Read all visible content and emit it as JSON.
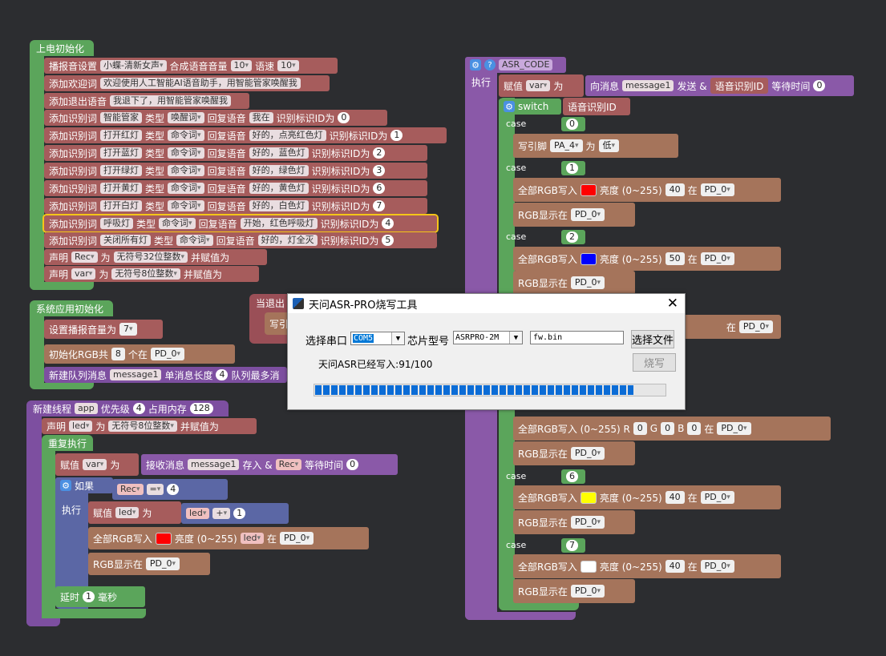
{
  "blocks": {
    "power_on": {
      "title": "上电初始化",
      "tts": {
        "label1": "播报音设置",
        "voice": "小蝶-清新女声",
        "label2": "合成语音音量",
        "volume": "10",
        "label3": "语速",
        "speed": "10"
      },
      "welcome": {
        "label": "添加欢迎词",
        "text": "欢迎使用人工智能AI语音助手，用智能管家唤醒我"
      },
      "exit": {
        "label": "添加退出语音",
        "text": "我退下了，用智能管家唤醒我"
      },
      "wake": {
        "label": "添加识别词",
        "word": "智能管家",
        "type_label": "类型",
        "type": "唤醒词",
        "reply_label": "回复语音",
        "reply": "我在",
        "id_label": "识别标识ID为",
        "id": "0"
      },
      "cmds": [
        {
          "label": "添加识别词",
          "word": "打开红灯",
          "type_label": "类型",
          "type": "命令词",
          "reply_label": "回复语音",
          "reply": "好的，点亮红色灯",
          "id_label": "识别标识ID为",
          "id": "1"
        },
        {
          "label": "添加识别词",
          "word": "打开蓝灯",
          "type_label": "类型",
          "type": "命令词",
          "reply_label": "回复语音",
          "reply": "好的，蓝色灯",
          "id_label": "识别标识ID为",
          "id": "2"
        },
        {
          "label": "添加识别词",
          "word": "打开绿灯",
          "type_label": "类型",
          "type": "命令词",
          "reply_label": "回复语音",
          "reply": "好的，绿色灯",
          "id_label": "识别标识ID为",
          "id": "3"
        },
        {
          "label": "添加识别词",
          "word": "打开黄灯",
          "type_label": "类型",
          "type": "命令词",
          "reply_label": "回复语音",
          "reply": "好的，黄色灯",
          "id_label": "识别标识ID为",
          "id": "6"
        },
        {
          "label": "添加识别词",
          "word": "打开白灯",
          "type_label": "类型",
          "type": "命令词",
          "reply_label": "回复语音",
          "reply": "好的，白色灯",
          "id_label": "识别标识ID为",
          "id": "7"
        },
        {
          "label": "添加识别词",
          "word": "呼吸灯",
          "type_label": "类型",
          "type": "命令词",
          "reply_label": "回复语音",
          "reply": "开始，红色呼吸灯",
          "id_label": "识别标识ID为",
          "id": "4"
        },
        {
          "label": "添加识别词",
          "word": "关闭所有灯",
          "type_label": "类型",
          "type": "命令词",
          "reply_label": "回复语音",
          "reply": "好的，灯全灭",
          "id_label": "识别标识ID为",
          "id": "5"
        }
      ],
      "decl1": {
        "label": "声明",
        "var": "Rec",
        "as": "为",
        "type": "无符号32位整数",
        "tail": "并赋值为"
      },
      "decl2": {
        "label": "声明",
        "var": "var",
        "as": "为",
        "type": "无符号8位整数",
        "tail": "并赋值为"
      }
    },
    "sys_init": {
      "title": "系统应用初始化",
      "vol": {
        "label": "设置播报音量为",
        "value": "7"
      },
      "rgb": {
        "label": "初始化RGB共",
        "count": "8",
        "mid": "个在",
        "pin": "PD_0"
      },
      "queue": {
        "label": "新建队列消息",
        "name": "message1",
        "len_label": "单消息长度",
        "len": "4",
        "tail": "队列最多消"
      }
    },
    "exit_block": {
      "title": "当退出",
      "inner": "写引"
    },
    "thread": {
      "title": "新建线程",
      "name": "app",
      "prio_label": "优先级",
      "prio": "4",
      "mem_label": "占用内存",
      "mem": "128",
      "decl": {
        "label": "声明",
        "var": "led",
        "as": "为",
        "type": "无符号8位整数",
        "tail": "并赋值为"
      },
      "loop": "重复执行",
      "assign": {
        "label": "赋值",
        "var": "var",
        "as": "为",
        "recv": "接收消息",
        "msg": "message1",
        "store": "存入 &",
        "target": "Rec",
        "wait": "等待时间",
        "time": "0"
      },
      "if": {
        "label": "如果",
        "lhs": "Rec",
        "op": "=",
        "rhs": "4"
      },
      "do": "执行",
      "assign2": {
        "label": "赋值",
        "var": "led",
        "as": "为",
        "lhs": "led",
        "op": "+",
        "rhs": "1"
      },
      "rgbw": {
        "label": "全部RGB写入",
        "bright": "亮度 (0~255)",
        "var": "led",
        "at": "在",
        "pin": "PD_0",
        "color": "#ff0000"
      },
      "show": {
        "label": "RGB显示在",
        "pin": "PD_0"
      },
      "delay": {
        "label": "延时",
        "value": "1",
        "unit": "毫秒"
      }
    },
    "asr": {
      "title": "ASR_CODE",
      "exec": "执行",
      "assign": {
        "label": "赋值",
        "var": "var",
        "as": "为",
        "send": "向消息",
        "msg": "message1",
        "send2": "发送 &",
        "src": "语音识别ID",
        "wait": "等待时间",
        "time": "0"
      },
      "switch": {
        "label": "switch",
        "value": "语音识别ID"
      },
      "case_label": "case",
      "case0": {
        "value": "0",
        "pin_label": "写引脚",
        "pin": "PA_4",
        "as": "为",
        "level": "低"
      },
      "case1": {
        "value": "1",
        "label": "全部RGB写入",
        "bright": "亮度 (0~255)",
        "val": "40",
        "at": "在",
        "pin": "PD_0",
        "color": "#ff0000"
      },
      "case2": {
        "value": "2",
        "label": "全部RGB写入",
        "bright": "亮度 (0~255)",
        "val": "50",
        "at": "在",
        "pin": "PD_0",
        "color": "#0000ff"
      },
      "case_hidden": {
        "at": "在",
        "pin": "PD_0"
      },
      "case5": {
        "label": "全部RGB写入 (0~255) R",
        "r": "0",
        "g_label": "G",
        "g": "0",
        "b_label": "B",
        "b": "0",
        "at": "在",
        "pin": "PD_0"
      },
      "case6": {
        "value": "6",
        "label": "全部RGB写入",
        "bright": "亮度 (0~255)",
        "val": "40",
        "at": "在",
        "pin": "PD_0",
        "color": "#ffff00"
      },
      "case7": {
        "value": "7",
        "label": "全部RGB写入",
        "bright": "亮度 (0~255)",
        "val": "40",
        "at": "在",
        "pin": "PD_0",
        "color": "#ffffff"
      },
      "show_label": "RGB显示在",
      "show_pin": "PD_0"
    }
  },
  "dialog": {
    "title": "天问ASR-PRO烧写工具",
    "port_label": "选择串口",
    "port": "COM5",
    "chip_label": "芯片型号",
    "chip": "ASRPRO-2M",
    "file": "fw.bin",
    "file_button": "选择文件",
    "burn_button": "烧写",
    "status": "天问ASR已经写入:91/100",
    "progress": 0.91,
    "accent": "#0b6cd6"
  }
}
